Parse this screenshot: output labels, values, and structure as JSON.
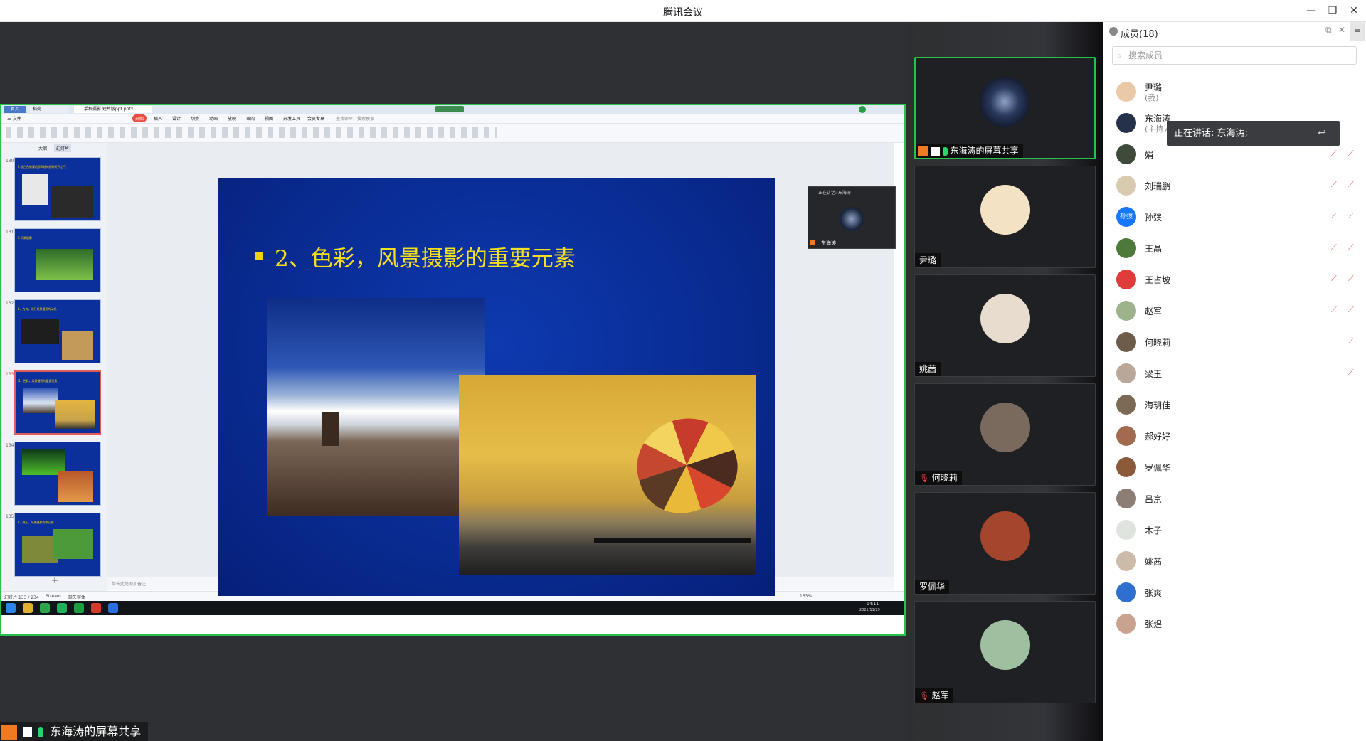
{
  "window": {
    "title": "腾讯会议"
  },
  "share_label": "东海涛的屏幕共享",
  "speaking": "正在讲话: 东海涛;",
  "members_panel": {
    "title": "成员(18)",
    "search_placeholder": "搜索成员",
    "members": [
      {
        "name": "尹璐",
        "sub": "(我)",
        "avatar": "#e9c9a8",
        "mic_off": false
      },
      {
        "name": "东海涛",
        "sub": "(主持人)",
        "avatar": "#25314a",
        "mic_off": true
      },
      {
        "name": "娟",
        "sub": "",
        "avatar": "#3e4b3a",
        "mic_off": true
      },
      {
        "name": "刘瑞鹏",
        "sub": "",
        "avatar": "#d8cbb0",
        "mic_off": true
      },
      {
        "name": "孙弢",
        "sub": "",
        "avatar": "#1677ff",
        "avatar_text": "孙弢",
        "mic_off": true
      },
      {
        "name": "王晶",
        "sub": "",
        "avatar": "#4d7a3a",
        "mic_off": true
      },
      {
        "name": "王占坡",
        "sub": "",
        "avatar": "#e03c3c",
        "mic_off": true
      },
      {
        "name": "赵军",
        "sub": "",
        "avatar": "#9db38b",
        "mic_off": true
      },
      {
        "name": "何晓莉",
        "sub": "",
        "avatar": "#6e5c4a",
        "mic_off": true
      },
      {
        "name": "梁玉",
        "sub": "",
        "avatar": "#b9a79a",
        "mic_off": true
      },
      {
        "name": "海玥佳",
        "sub": "",
        "avatar": "#7d6a55",
        "mic_off": false
      },
      {
        "name": "郝好好",
        "sub": "",
        "avatar": "#a26b50",
        "mic_off": false
      },
      {
        "name": "罗佩华",
        "sub": "",
        "avatar": "#8a5a3b",
        "mic_off": false
      },
      {
        "name": "吕京",
        "sub": "",
        "avatar": "#8c7e74",
        "mic_off": false
      },
      {
        "name": "木子",
        "sub": "",
        "avatar": "#dfe4df",
        "mic_off": false
      },
      {
        "name": "姚茜",
        "sub": "",
        "avatar": "#cbbba8",
        "mic_off": false
      },
      {
        "name": "张爽",
        "sub": "",
        "avatar": "#2f6fd0",
        "mic_off": false
      },
      {
        "name": "张煜",
        "sub": "",
        "avatar": "#c9a390",
        "mic_off": false
      }
    ]
  },
  "video_tiles": [
    {
      "name": "东海涛的屏幕共享",
      "avatar": "#1c2840",
      "active": true
    },
    {
      "name": "尹璐",
      "avatar": "#f4e2c4",
      "active": false
    },
    {
      "name": "姚茜",
      "avatar": "#e7dccd",
      "active": false
    },
    {
      "name": "何晓莉",
      "avatar": "#7a6a5d",
      "active": false,
      "mic_off": true
    },
    {
      "name": "罗佩华",
      "avatar": "#a3462d",
      "active": false
    },
    {
      "name": "赵军",
      "avatar": "#9fbfa1",
      "active": false,
      "mic_off": true
    }
  ],
  "ppt": {
    "tabs": [
      "首页",
      "稻壳",
      "手机摄影 短片版ppt.pptx"
    ],
    "menu": [
      "三 文件",
      "开始",
      "插入",
      "设计",
      "切换",
      "动画",
      "放映",
      "审阅",
      "视图",
      "开发工具",
      "会员专享"
    ],
    "search_hint": "查找命令、搜索模板",
    "panel_tabs": [
      "大纲",
      "幻灯片"
    ],
    "slide_title": "2、色彩，风景摄影的重要元素",
    "slide_numbers": [
      "130",
      "131",
      "132",
      "133",
      "134",
      "135"
    ],
    "thumb_titles": [
      "2.那白色像漫地那风格的那种灵气之气",
      "2.风景摄影",
      "1、为何，进行风景摄影的动机",
      "2、色彩，风景摄影的重要元素",
      "",
      "3、快乐，风景摄影的中心钥"
    ],
    "notes_hint": "单击此处添加备注",
    "status": "幻灯片 133 / 234",
    "theme": "Stream",
    "font_missing": "缺失字体",
    "zoom": "163%",
    "mini_speaking": "正在讲话: 东海涛",
    "mini_name": "东海涛",
    "clock_time": "14:11",
    "clock_date": "2021/11/29"
  }
}
